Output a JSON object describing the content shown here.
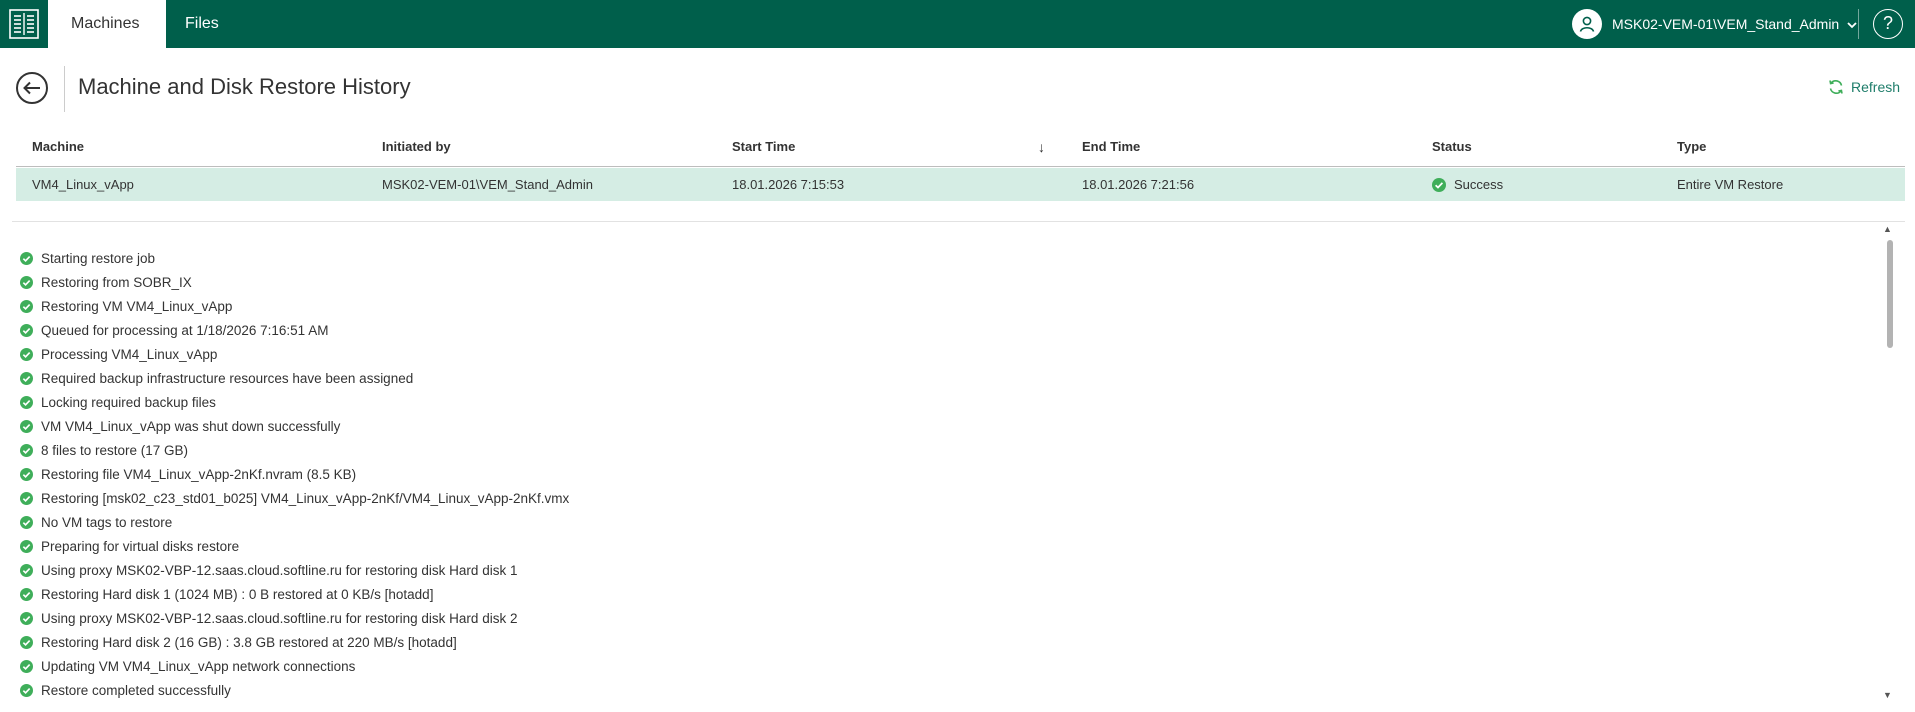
{
  "topbar": {
    "tabs": [
      {
        "label": "Machines",
        "active": true
      },
      {
        "label": "Files",
        "active": false
      }
    ],
    "user": "MSK02-VEM-01\\VEM_Stand_Admin",
    "help_label": "?"
  },
  "page": {
    "title": "Machine and Disk Restore History",
    "refresh_label": "Refresh"
  },
  "table": {
    "columns": [
      "Machine",
      "Initiated by",
      "Start Time",
      "End Time",
      "Status",
      "Type"
    ],
    "sort_indicator": "↓",
    "rows": [
      {
        "machine": "VM4_Linux_vApp",
        "initiated_by": "MSK02-VEM-01\\VEM_Stand_Admin",
        "start_time": "18.01.2026 7:15:53",
        "end_time": "18.01.2026 7:21:56",
        "status": "Success",
        "type": "Entire VM Restore"
      }
    ]
  },
  "log": [
    "Starting restore job",
    "Restoring from SOBR_IX",
    "Restoring VM VM4_Linux_vApp",
    "Queued for processing at 1/18/2026 7:16:51 AM",
    "Processing VM4_Linux_vApp",
    "Required backup infrastructure resources have been assigned",
    "Locking required backup files",
    "VM VM4_Linux_vApp was shut down successfully",
    "8 files to restore (17 GB)",
    "Restoring file VM4_Linux_vApp-2nKf.nvram (8.5 KB)",
    "Restoring [msk02_c23_std01_b025] VM4_Linux_vApp-2nKf/VM4_Linux_vApp-2nKf.vmx",
    "No VM tags to restore",
    "Preparing for virtual disks restore",
    "Using proxy MSK02-VBP-12.saas.cloud.softline.ru for restoring disk Hard disk 1",
    "Restoring Hard disk 1 (1024 MB) : 0 B restored at 0 KB/s [hotadd]",
    "Using proxy MSK02-VBP-12.saas.cloud.softline.ru for restoring disk Hard disk 2",
    "Restoring Hard disk 2 (16 GB) : 3.8 GB restored at 220 MB/s [hotadd]",
    "Updating VM VM4_Linux_vApp network connections",
    "Restore completed successfully"
  ],
  "colors": {
    "brand": "#005f4b",
    "selected_row": "#d5ede4",
    "success": "#3fae5a",
    "link": "#1e7d6a"
  },
  "icons": {
    "logo": "app-logo-icon",
    "user": "user-icon",
    "back": "back-arrow-icon",
    "refresh": "refresh-icon",
    "success": "success-check-icon"
  }
}
